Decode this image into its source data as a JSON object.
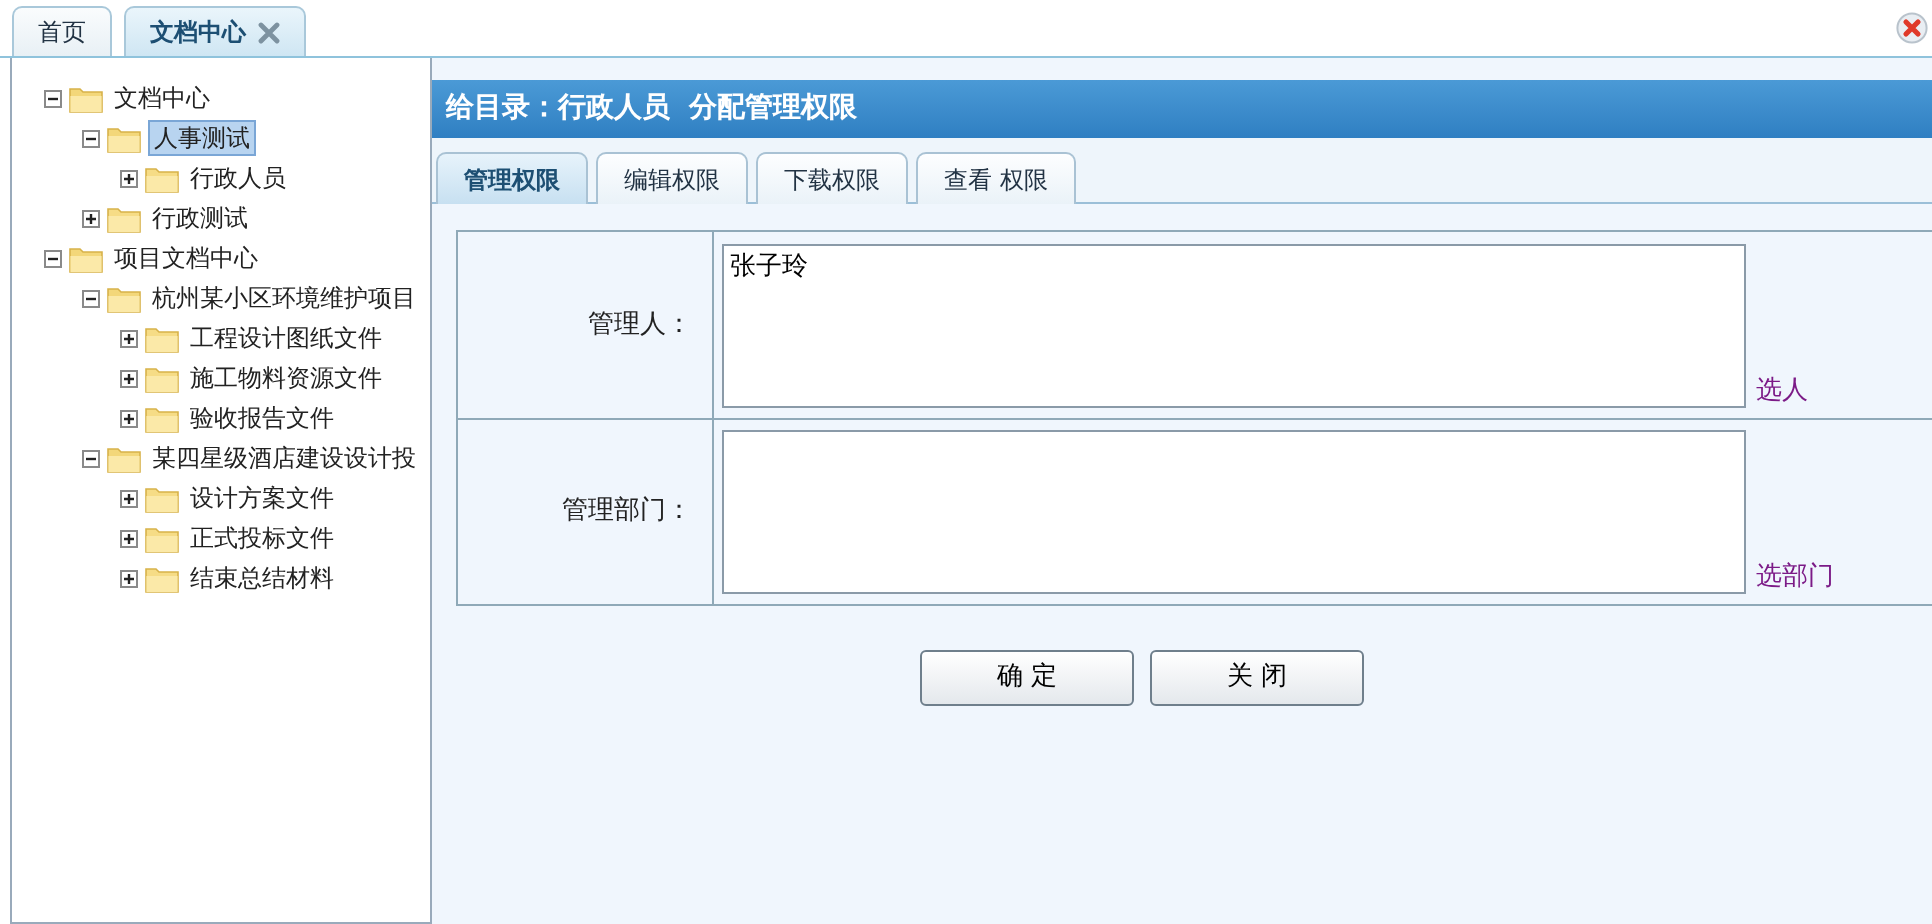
{
  "top_tabs": [
    {
      "label": "首页",
      "selected": false,
      "closable": false
    },
    {
      "label": "文档中心",
      "selected": true,
      "closable": true
    }
  ],
  "tree": [
    {
      "label": "文档中心",
      "expanded": true,
      "selected": false,
      "children": [
        {
          "label": "人事测试",
          "expanded": true,
          "selected": true,
          "children": [
            {
              "label": "行政人员",
              "expanded": false,
              "selected": false
            }
          ]
        },
        {
          "label": "行政测试",
          "expanded": false,
          "selected": false
        }
      ]
    },
    {
      "label": "项目文档中心",
      "expanded": true,
      "selected": false,
      "children": [
        {
          "label": "杭州某小区环境维护项目",
          "expanded": true,
          "selected": false,
          "children": [
            {
              "label": "工程设计图纸文件",
              "expanded": false,
              "selected": false
            },
            {
              "label": "施工物料资源文件",
              "expanded": false,
              "selected": false
            },
            {
              "label": "验收报告文件",
              "expanded": false,
              "selected": false
            }
          ]
        },
        {
          "label": "某四星级酒店建设设计投",
          "expanded": true,
          "selected": false,
          "children": [
            {
              "label": "设计方案文件",
              "expanded": false,
              "selected": false
            },
            {
              "label": "正式投标文件",
              "expanded": false,
              "selected": false
            },
            {
              "label": "结束总结材料",
              "expanded": false,
              "selected": false
            }
          ]
        }
      ]
    }
  ],
  "panel": {
    "title": "给目录：行政人员  分配管理权限",
    "tabs": [
      {
        "label": "管理权限",
        "selected": true
      },
      {
        "label": "编辑权限",
        "selected": false
      },
      {
        "label": "下载权限",
        "selected": false
      },
      {
        "label": "查看 权限",
        "selected": false
      }
    ],
    "fields": [
      {
        "label": "管理人：",
        "value": "张子玲",
        "action": "选人"
      },
      {
        "label": "管理部门：",
        "action": "选部门"
      }
    ],
    "buttons": [
      "确 定",
      "关 闭"
    ]
  }
}
